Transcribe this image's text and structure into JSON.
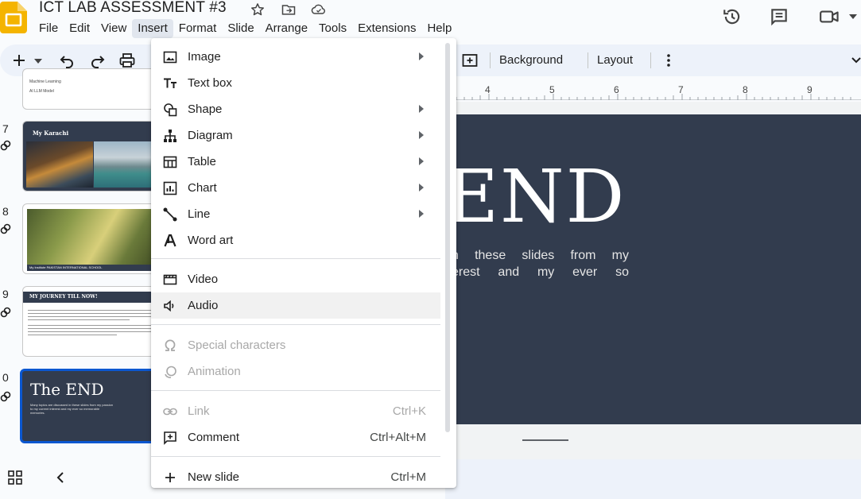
{
  "app": {
    "accent_color": "#0b57d0",
    "slide_bg_color": "#323c4e"
  },
  "title": {
    "document_name": "ICT LAB ASSESSMENT #3"
  },
  "menubar": [
    "File",
    "Edit",
    "View",
    "Insert",
    "Format",
    "Slide",
    "Arrange",
    "Tools",
    "Extensions",
    "Help"
  ],
  "toolbar": {
    "background_label": "Background",
    "layout_label": "Layout"
  },
  "ruler": {
    "numbers": [
      "4",
      "5",
      "6",
      "7",
      "8",
      "9"
    ]
  },
  "filmstrip": {
    "slide6_bullets": [
      "Machine Learning",
      "AI LLM Model"
    ],
    "slides": [
      {
        "number": "7",
        "title": "My Karachi"
      },
      {
        "number": "8",
        "caption": "My Institute PAKISTAN INTERNATIONAL SCHOOL"
      },
      {
        "number": "9",
        "title": "MY JOURNEY TILL NOW!"
      },
      {
        "number": "0",
        "title": "The END",
        "body": "Many topics are discussed in these slides from my passion to my current interest and my ever so memorable memories."
      }
    ]
  },
  "slide": {
    "big_text": "END",
    "body_lines": [
      "n  these  slides  from  my",
      "erest   and   my   ever   so"
    ]
  },
  "insert_menu": {
    "items": [
      {
        "label": "Image",
        "icon": "image-icon",
        "submenu": true
      },
      {
        "label": "Text box",
        "icon": "textbox-icon",
        "submenu": false
      },
      {
        "label": "Shape",
        "icon": "shape-icon",
        "submenu": true
      },
      {
        "label": "Diagram",
        "icon": "diagram-icon",
        "submenu": true
      },
      {
        "label": "Table",
        "icon": "table-icon",
        "submenu": true
      },
      {
        "label": "Chart",
        "icon": "chart-icon",
        "submenu": true
      },
      {
        "label": "Line",
        "icon": "line-icon",
        "submenu": true
      },
      {
        "label": "Word art",
        "icon": "wordart-icon",
        "submenu": false
      },
      {
        "label": "Video",
        "icon": "video-icon",
        "submenu": false
      },
      {
        "label": "Audio",
        "icon": "audio-icon",
        "submenu": false
      },
      {
        "label": "Special characters",
        "icon": "omega-icon",
        "submenu": false,
        "disabled": true
      },
      {
        "label": "Animation",
        "icon": "animation-icon",
        "submenu": false,
        "disabled": true
      },
      {
        "label": "Link",
        "icon": "link-icon",
        "shortcut": "Ctrl+K",
        "disabled": true
      },
      {
        "label": "Comment",
        "icon": "comment-icon",
        "shortcut": "Ctrl+Alt+M"
      },
      {
        "label": "New slide",
        "icon": "plus-icon",
        "shortcut": "Ctrl+M"
      }
    ]
  }
}
